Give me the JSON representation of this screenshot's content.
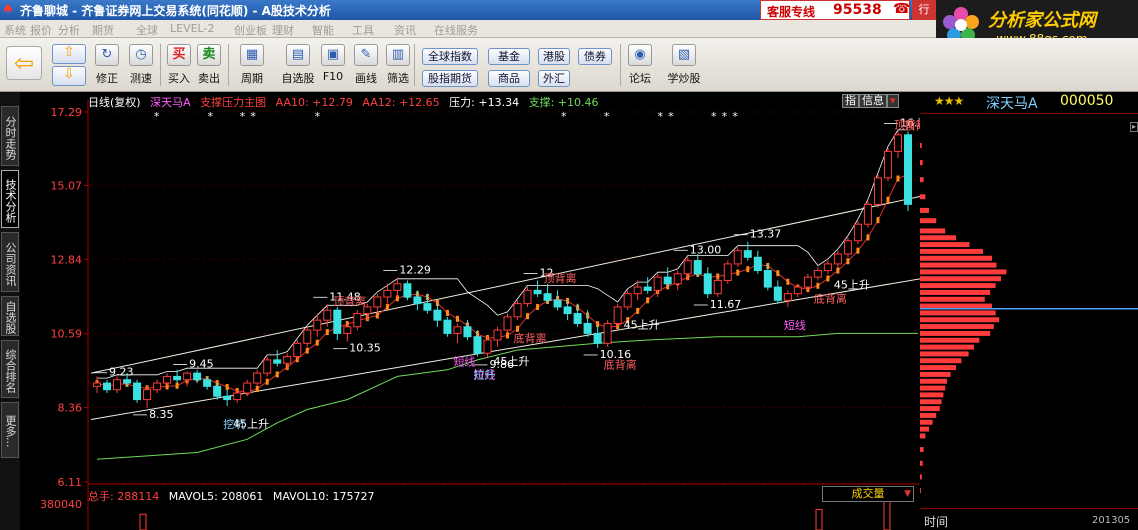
{
  "titlebar": {
    "title": "齐鲁聊城 - 齐鲁证券网上交易系统(同花顺) - A股技术分析",
    "hotline_label": "客服专线",
    "hotline_number": "95538",
    "trade_tab": "行"
  },
  "brand": {
    "name": "分析家公式网",
    "url": "www.88gs.com"
  },
  "menu": [
    "系统",
    "报价",
    "分析",
    "期货",
    "全球",
    "LEVEL-2",
    "创业板",
    "理财",
    "智能",
    "工具",
    "资讯",
    "在线服务"
  ],
  "toolbar": {
    "buttons": [
      {
        "label": "修正",
        "icon": "refresh-icon"
      },
      {
        "label": "测速",
        "icon": "clock-icon"
      },
      {
        "label": "买入",
        "icon": "buy-icon",
        "glyph": "买"
      },
      {
        "label": "卖出",
        "icon": "sell-icon",
        "glyph": "卖"
      },
      {
        "label": "周期",
        "icon": "period-icon"
      },
      {
        "label": "自选股",
        "icon": "folder-icon"
      },
      {
        "label": "F10",
        "icon": "f10-icon"
      },
      {
        "label": "画线",
        "icon": "pencil-icon"
      },
      {
        "label": "筛选",
        "icon": "filter-icon"
      },
      {
        "label": "论坛",
        "icon": "forum-icon"
      },
      {
        "label": "学炒股",
        "icon": "book-icon"
      }
    ],
    "quick_buttons": [
      "全球指数",
      "基金",
      "港股",
      "债券",
      "股指期货",
      "商品",
      "外汇"
    ]
  },
  "left_tabs": [
    "分时走势",
    "技术分析",
    "公司资讯",
    "自选股",
    "综合排名",
    "更多..."
  ],
  "active_left_tab": 1,
  "chart_header": {
    "period": "日线(复权)",
    "stock": "深天马A",
    "formula": "支撑压力主图",
    "aa10": "AA10: +12.79",
    "aa12": "AA12: +12.65",
    "pressure": "压力: +13.34",
    "support": "支撑: +10.46"
  },
  "info_tabs": [
    "指",
    "信息",
    "▾"
  ],
  "stock_header": {
    "stars": "★★★",
    "name": "深天马A",
    "code": "000050"
  },
  "volume": {
    "total": "总手: 288114",
    "mavol5": "MAVOL5: 208061",
    "mavol10": "MAVOL10: 175727",
    "indicator": "成交量",
    "axis_label": "380040"
  },
  "time_bar": {
    "label": "时间",
    "date": "201305"
  },
  "colors": {
    "up": "#ff3b3b",
    "down": "#3de0e0",
    "ma": "#e03030",
    "support_line": "#6fdc5a",
    "channel": "#f0f0e0",
    "label": "#ff6060"
  },
  "chart_data": {
    "type": "candlestick",
    "ylim": [
      6.11,
      17.29
    ],
    "y_ticks": [
      "17.29",
      "15.07",
      "12.84",
      "10.59",
      "8.36",
      "6.11"
    ],
    "candles": [
      [
        9.0,
        9.3,
        8.8,
        9.1
      ],
      [
        9.1,
        9.2,
        8.8,
        8.9
      ],
      [
        8.9,
        9.3,
        8.8,
        9.2
      ],
      [
        9.2,
        9.4,
        9.0,
        9.1
      ],
      [
        9.1,
        9.2,
        8.5,
        8.6
      ],
      [
        8.6,
        9.0,
        8.35,
        8.9
      ],
      [
        8.9,
        9.2,
        8.8,
        9.1
      ],
      [
        9.1,
        9.4,
        9.0,
        9.3
      ],
      [
        9.3,
        9.5,
        9.1,
        9.2
      ],
      [
        9.2,
        9.45,
        9.0,
        9.4
      ],
      [
        9.4,
        9.5,
        9.1,
        9.2
      ],
      [
        9.2,
        9.3,
        8.9,
        9.0
      ],
      [
        9.0,
        9.1,
        8.6,
        8.7
      ],
      [
        8.7,
        8.9,
        8.4,
        8.6
      ],
      [
        8.6,
        8.9,
        8.5,
        8.8
      ],
      [
        8.8,
        9.2,
        8.7,
        9.1
      ],
      [
        9.1,
        9.5,
        9.0,
        9.4
      ],
      [
        9.4,
        9.9,
        9.3,
        9.8
      ],
      [
        9.8,
        10.1,
        9.6,
        9.7
      ],
      [
        9.7,
        10.0,
        9.5,
        9.9
      ],
      [
        9.9,
        10.4,
        9.8,
        10.3
      ],
      [
        10.3,
        10.8,
        10.2,
        10.7
      ],
      [
        10.7,
        11.2,
        10.5,
        11.0
      ],
      [
        11.0,
        11.48,
        10.8,
        11.3
      ],
      [
        11.3,
        11.4,
        10.4,
        10.6
      ],
      [
        10.6,
        10.9,
        10.35,
        10.8
      ],
      [
        10.8,
        11.3,
        10.7,
        11.2
      ],
      [
        11.2,
        11.5,
        11.0,
        11.4
      ],
      [
        11.4,
        11.8,
        11.2,
        11.7
      ],
      [
        11.7,
        12.1,
        11.5,
        11.9
      ],
      [
        11.9,
        12.29,
        11.7,
        12.1
      ],
      [
        12.1,
        12.2,
        11.6,
        11.7
      ],
      [
        11.7,
        11.9,
        11.3,
        11.5
      ],
      [
        11.5,
        11.8,
        11.2,
        11.3
      ],
      [
        11.3,
        11.5,
        10.8,
        11.0
      ],
      [
        11.0,
        11.1,
        10.5,
        10.6
      ],
      [
        10.6,
        10.9,
        10.3,
        10.8
      ],
      [
        10.8,
        11.0,
        10.4,
        10.5
      ],
      [
        10.5,
        10.7,
        9.9,
        10.0
      ],
      [
        10.0,
        10.5,
        9.86,
        10.4
      ],
      [
        10.4,
        10.8,
        10.2,
        10.7
      ],
      [
        10.7,
        11.2,
        10.6,
        11.1
      ],
      [
        11.1,
        11.6,
        11.0,
        11.5
      ],
      [
        11.5,
        12.0,
        11.4,
        11.9
      ],
      [
        11.9,
        12.2,
        11.7,
        11.8
      ],
      [
        11.8,
        12.1,
        11.5,
        11.6
      ],
      [
        11.6,
        11.9,
        11.3,
        11.4
      ],
      [
        11.4,
        11.6,
        11.0,
        11.2
      ],
      [
        11.2,
        11.5,
        10.8,
        10.9
      ],
      [
        10.9,
        11.3,
        10.5,
        10.6
      ],
      [
        10.6,
        10.8,
        10.16,
        10.3
      ],
      [
        10.3,
        11.0,
        10.2,
        10.9
      ],
      [
        10.9,
        11.5,
        10.8,
        11.4
      ],
      [
        11.4,
        11.9,
        11.3,
        11.8
      ],
      [
        11.8,
        12.2,
        11.6,
        12.0
      ],
      [
        12.0,
        12.3,
        11.8,
        11.9
      ],
      [
        11.9,
        12.4,
        11.7,
        12.3
      ],
      [
        12.3,
        12.6,
        12.0,
        12.1
      ],
      [
        12.1,
        12.5,
        11.9,
        12.4
      ],
      [
        12.4,
        12.9,
        12.2,
        12.8
      ],
      [
        12.8,
        13.0,
        12.3,
        12.4
      ],
      [
        12.4,
        12.6,
        11.67,
        11.8
      ],
      [
        11.8,
        12.3,
        11.7,
        12.2
      ],
      [
        12.2,
        12.8,
        12.1,
        12.7
      ],
      [
        12.7,
        13.2,
        12.6,
        13.1
      ],
      [
        13.1,
        13.37,
        12.8,
        12.9
      ],
      [
        12.9,
        13.1,
        12.4,
        12.5
      ],
      [
        12.5,
        12.7,
        11.9,
        12.0
      ],
      [
        12.0,
        12.2,
        11.5,
        11.6
      ],
      [
        11.6,
        11.9,
        11.4,
        11.8
      ],
      [
        11.8,
        12.1,
        11.7,
        12.0
      ],
      [
        12.0,
        12.4,
        11.9,
        12.3
      ],
      [
        12.3,
        12.6,
        12.2,
        12.5
      ],
      [
        12.5,
        12.8,
        12.4,
        12.7
      ],
      [
        12.7,
        13.1,
        12.6,
        13.0
      ],
      [
        13.0,
        13.5,
        12.9,
        13.4
      ],
      [
        13.4,
        14.0,
        13.3,
        13.9
      ],
      [
        13.9,
        14.6,
        13.8,
        14.5
      ],
      [
        14.5,
        15.4,
        14.4,
        15.3
      ],
      [
        15.3,
        16.2,
        15.2,
        16.1
      ],
      [
        16.1,
        16.73,
        15.9,
        16.6
      ],
      [
        16.6,
        16.7,
        14.3,
        14.5
      ]
    ],
    "annotations": [
      {
        "i": 1,
        "text": "9.23",
        "kind": "high"
      },
      {
        "i": 5,
        "text": "8.35",
        "kind": "low"
      },
      {
        "i": 9,
        "text": "9.45",
        "kind": "high"
      },
      {
        "i": 23,
        "text": "11.48",
        "kind": "high"
      },
      {
        "i": 25,
        "text": "10.35",
        "kind": "low"
      },
      {
        "i": 30,
        "text": "12.29",
        "kind": "high"
      },
      {
        "i": 39,
        "text": "9.86",
        "kind": "low"
      },
      {
        "i": 44,
        "text": "12",
        "kind": "high"
      },
      {
        "i": 50,
        "text": "10.16",
        "kind": "low"
      },
      {
        "i": 61,
        "text": "11.67",
        "kind": "low"
      },
      {
        "i": 59,
        "text": "13.00",
        "kind": "high"
      },
      {
        "i": 65,
        "text": "13.37",
        "kind": "high"
      },
      {
        "i": 80,
        "text": "16.73",
        "kind": "high"
      }
    ],
    "signals": [
      {
        "i": 13,
        "text": "挖坑",
        "color": "#7fd0ff",
        "below": true
      },
      {
        "i": 14,
        "text": "45上升",
        "color": "#ffffff",
        "below": false
      },
      {
        "i": 24,
        "text": "顶背离",
        "color": "#ff6060",
        "below": false
      },
      {
        "i": 36,
        "text": "短线",
        "color": "#ff60ff",
        "below": true
      },
      {
        "i": 38,
        "text": "短线",
        "color": "#ff60ff",
        "below": true
      },
      {
        "i": 38,
        "text": "拉升",
        "color": "#7fd0ff",
        "below": true
      },
      {
        "i": 40,
        "text": "45上升",
        "color": "#ffffff",
        "below": false
      },
      {
        "i": 42,
        "text": "底背离",
        "color": "#ff6060",
        "below": true
      },
      {
        "i": 45,
        "text": "顶背离",
        "color": "#ff6060",
        "below": false
      },
      {
        "i": 51,
        "text": "底背离",
        "color": "#ff6060",
        "below": true
      },
      {
        "i": 53,
        "text": "45上升",
        "color": "#ffffff",
        "below": false
      },
      {
        "i": 69,
        "text": "短线",
        "color": "#ff60ff",
        "below": true
      },
      {
        "i": 72,
        "text": "底背离",
        "color": "#ff6060",
        "below": true
      },
      {
        "i": 74,
        "text": "45上升",
        "color": "#ffffff",
        "below": false
      },
      {
        "i": 80,
        "text": "顶背离",
        "color": "#ff6060",
        "below": false
      },
      {
        "i": 81,
        "text": "顶背离",
        "color": "#ff6060",
        "below": false
      }
    ],
    "star_marks": [
      6,
      11,
      14,
      15,
      21,
      44,
      48,
      53,
      54,
      58,
      59,
      60
    ],
    "support_line": [
      [
        0,
        6.8
      ],
      [
        10,
        7.0
      ],
      [
        15,
        7.4
      ],
      [
        18,
        7.9
      ],
      [
        21,
        8.3
      ],
      [
        25,
        8.6
      ],
      [
        30,
        9.3
      ],
      [
        35,
        9.5
      ],
      [
        38,
        9.8
      ],
      [
        42,
        10.1
      ],
      [
        46,
        10.2
      ],
      [
        50,
        10.3
      ],
      [
        55,
        10.4
      ],
      [
        62,
        10.5
      ],
      [
        70,
        10.5
      ],
      [
        74,
        10.6
      ],
      [
        82,
        10.6
      ]
    ],
    "channel_upper": [
      [
        0,
        9.4
      ],
      [
        84,
        14.8
      ]
    ],
    "channel_lower": [
      [
        0,
        8.0
      ],
      [
        84,
        12.3
      ]
    ],
    "profile": [
      [
        16.5,
        2
      ],
      [
        16.0,
        3
      ],
      [
        15.5,
        4
      ],
      [
        15.0,
        6
      ],
      [
        14.6,
        10
      ],
      [
        14.3,
        18
      ],
      [
        14.0,
        28
      ],
      [
        13.8,
        40
      ],
      [
        13.6,
        55
      ],
      [
        13.4,
        70
      ],
      [
        13.2,
        80
      ],
      [
        13.0,
        85
      ],
      [
        12.8,
        96
      ],
      [
        12.6,
        90
      ],
      [
        12.4,
        84
      ],
      [
        12.2,
        78
      ],
      [
        12.0,
        72
      ],
      [
        11.8,
        80
      ],
      [
        11.6,
        84
      ],
      [
        11.4,
        88
      ],
      [
        11.2,
        82
      ],
      [
        11.0,
        78
      ],
      [
        10.8,
        66
      ],
      [
        10.6,
        60
      ],
      [
        10.4,
        54
      ],
      [
        10.2,
        46
      ],
      [
        10.0,
        40
      ],
      [
        9.8,
        34
      ],
      [
        9.6,
        30
      ],
      [
        9.4,
        28
      ],
      [
        9.2,
        26
      ],
      [
        9.0,
        24
      ],
      [
        8.8,
        22
      ],
      [
        8.6,
        18
      ],
      [
        8.4,
        14
      ],
      [
        8.2,
        10
      ],
      [
        8.0,
        6
      ],
      [
        7.6,
        4
      ],
      [
        7.2,
        3
      ],
      [
        6.8,
        2
      ],
      [
        6.4,
        1
      ]
    ],
    "current_price": 11.65,
    "volume_values": [
      380040,
      200000,
      260000
    ]
  }
}
